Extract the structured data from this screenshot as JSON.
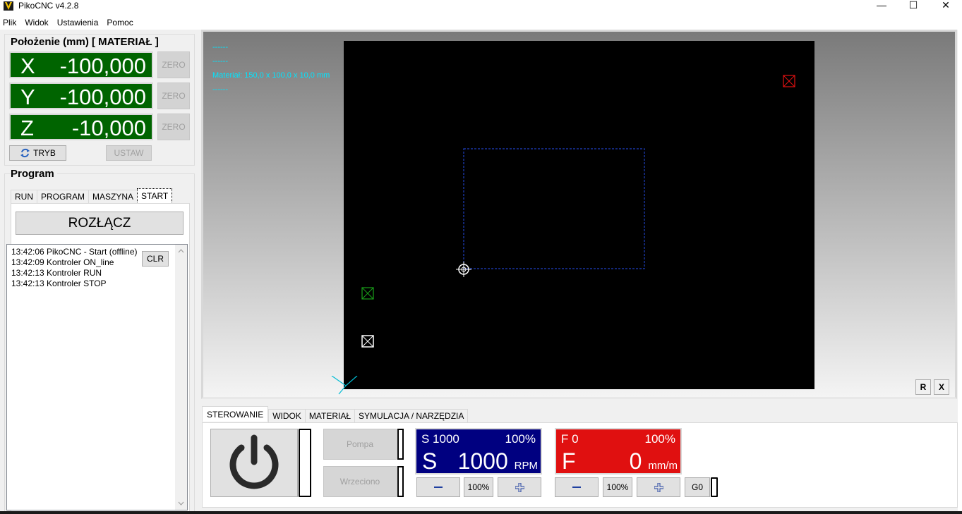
{
  "window": {
    "title": "PikoCNC v4.2.8",
    "min_glyph": "—",
    "max_glyph": "☐",
    "close_glyph": "✕"
  },
  "menu": [
    "Plik",
    "Widok",
    "Ustawienia",
    "Pomoc"
  ],
  "position": {
    "title": "Położenie (mm) [ MATERIAŁ ]",
    "axes": [
      {
        "letter": "X",
        "value": "-100,000",
        "zero_label": "ZERO"
      },
      {
        "letter": "Y",
        "value": "-100,000",
        "zero_label": "ZERO"
      },
      {
        "letter": "Z",
        "value": "-10,000",
        "zero_label": "ZERO"
      }
    ],
    "mode_label": "TRYB",
    "set_label": "USTAW"
  },
  "program": {
    "title": "Program",
    "tabs": [
      "RUN",
      "PROGRAM",
      "MASZYNA",
      "START"
    ],
    "active_tab": "START",
    "disconnect_label": "ROZŁĄCZ",
    "clear_label": "CLR",
    "log": [
      "13:42:06 PikoCNC - Start (offline)",
      "13:42:09 Kontroler ON_line",
      "13:42:13 Kontroler RUN",
      "13:42:13 Kontroler STOP"
    ]
  },
  "view": {
    "info_lines": [
      "------",
      "------",
      "Materiał: 150,0 x 100,0 x 10,0 mm",
      "------"
    ],
    "r_label": "R",
    "x_label": "X"
  },
  "control": {
    "tabs": [
      "STEROWANIE",
      "WIDOK",
      "MATERIAŁ",
      "SYMULACJA / NARZĘDZIA"
    ],
    "active_tab": "STEROWANIE",
    "pump_label": "Pompa",
    "spindle_label": "Wrzeciono",
    "spindle": {
      "set": "S 1000",
      "percent": "100%",
      "letter": "S",
      "value": "1000",
      "unit": "RPM",
      "override_label": "100%"
    },
    "feed": {
      "set": "F 0",
      "percent": "100%",
      "letter": "F",
      "value": "0",
      "unit": "mm/m",
      "override_label": "100%"
    },
    "g0_label": "G0"
  },
  "colors": {
    "axis_bg": "#006400",
    "spindle_bg": "#000080",
    "feed_bg": "#e01010",
    "info_text": "#00e5ff"
  }
}
